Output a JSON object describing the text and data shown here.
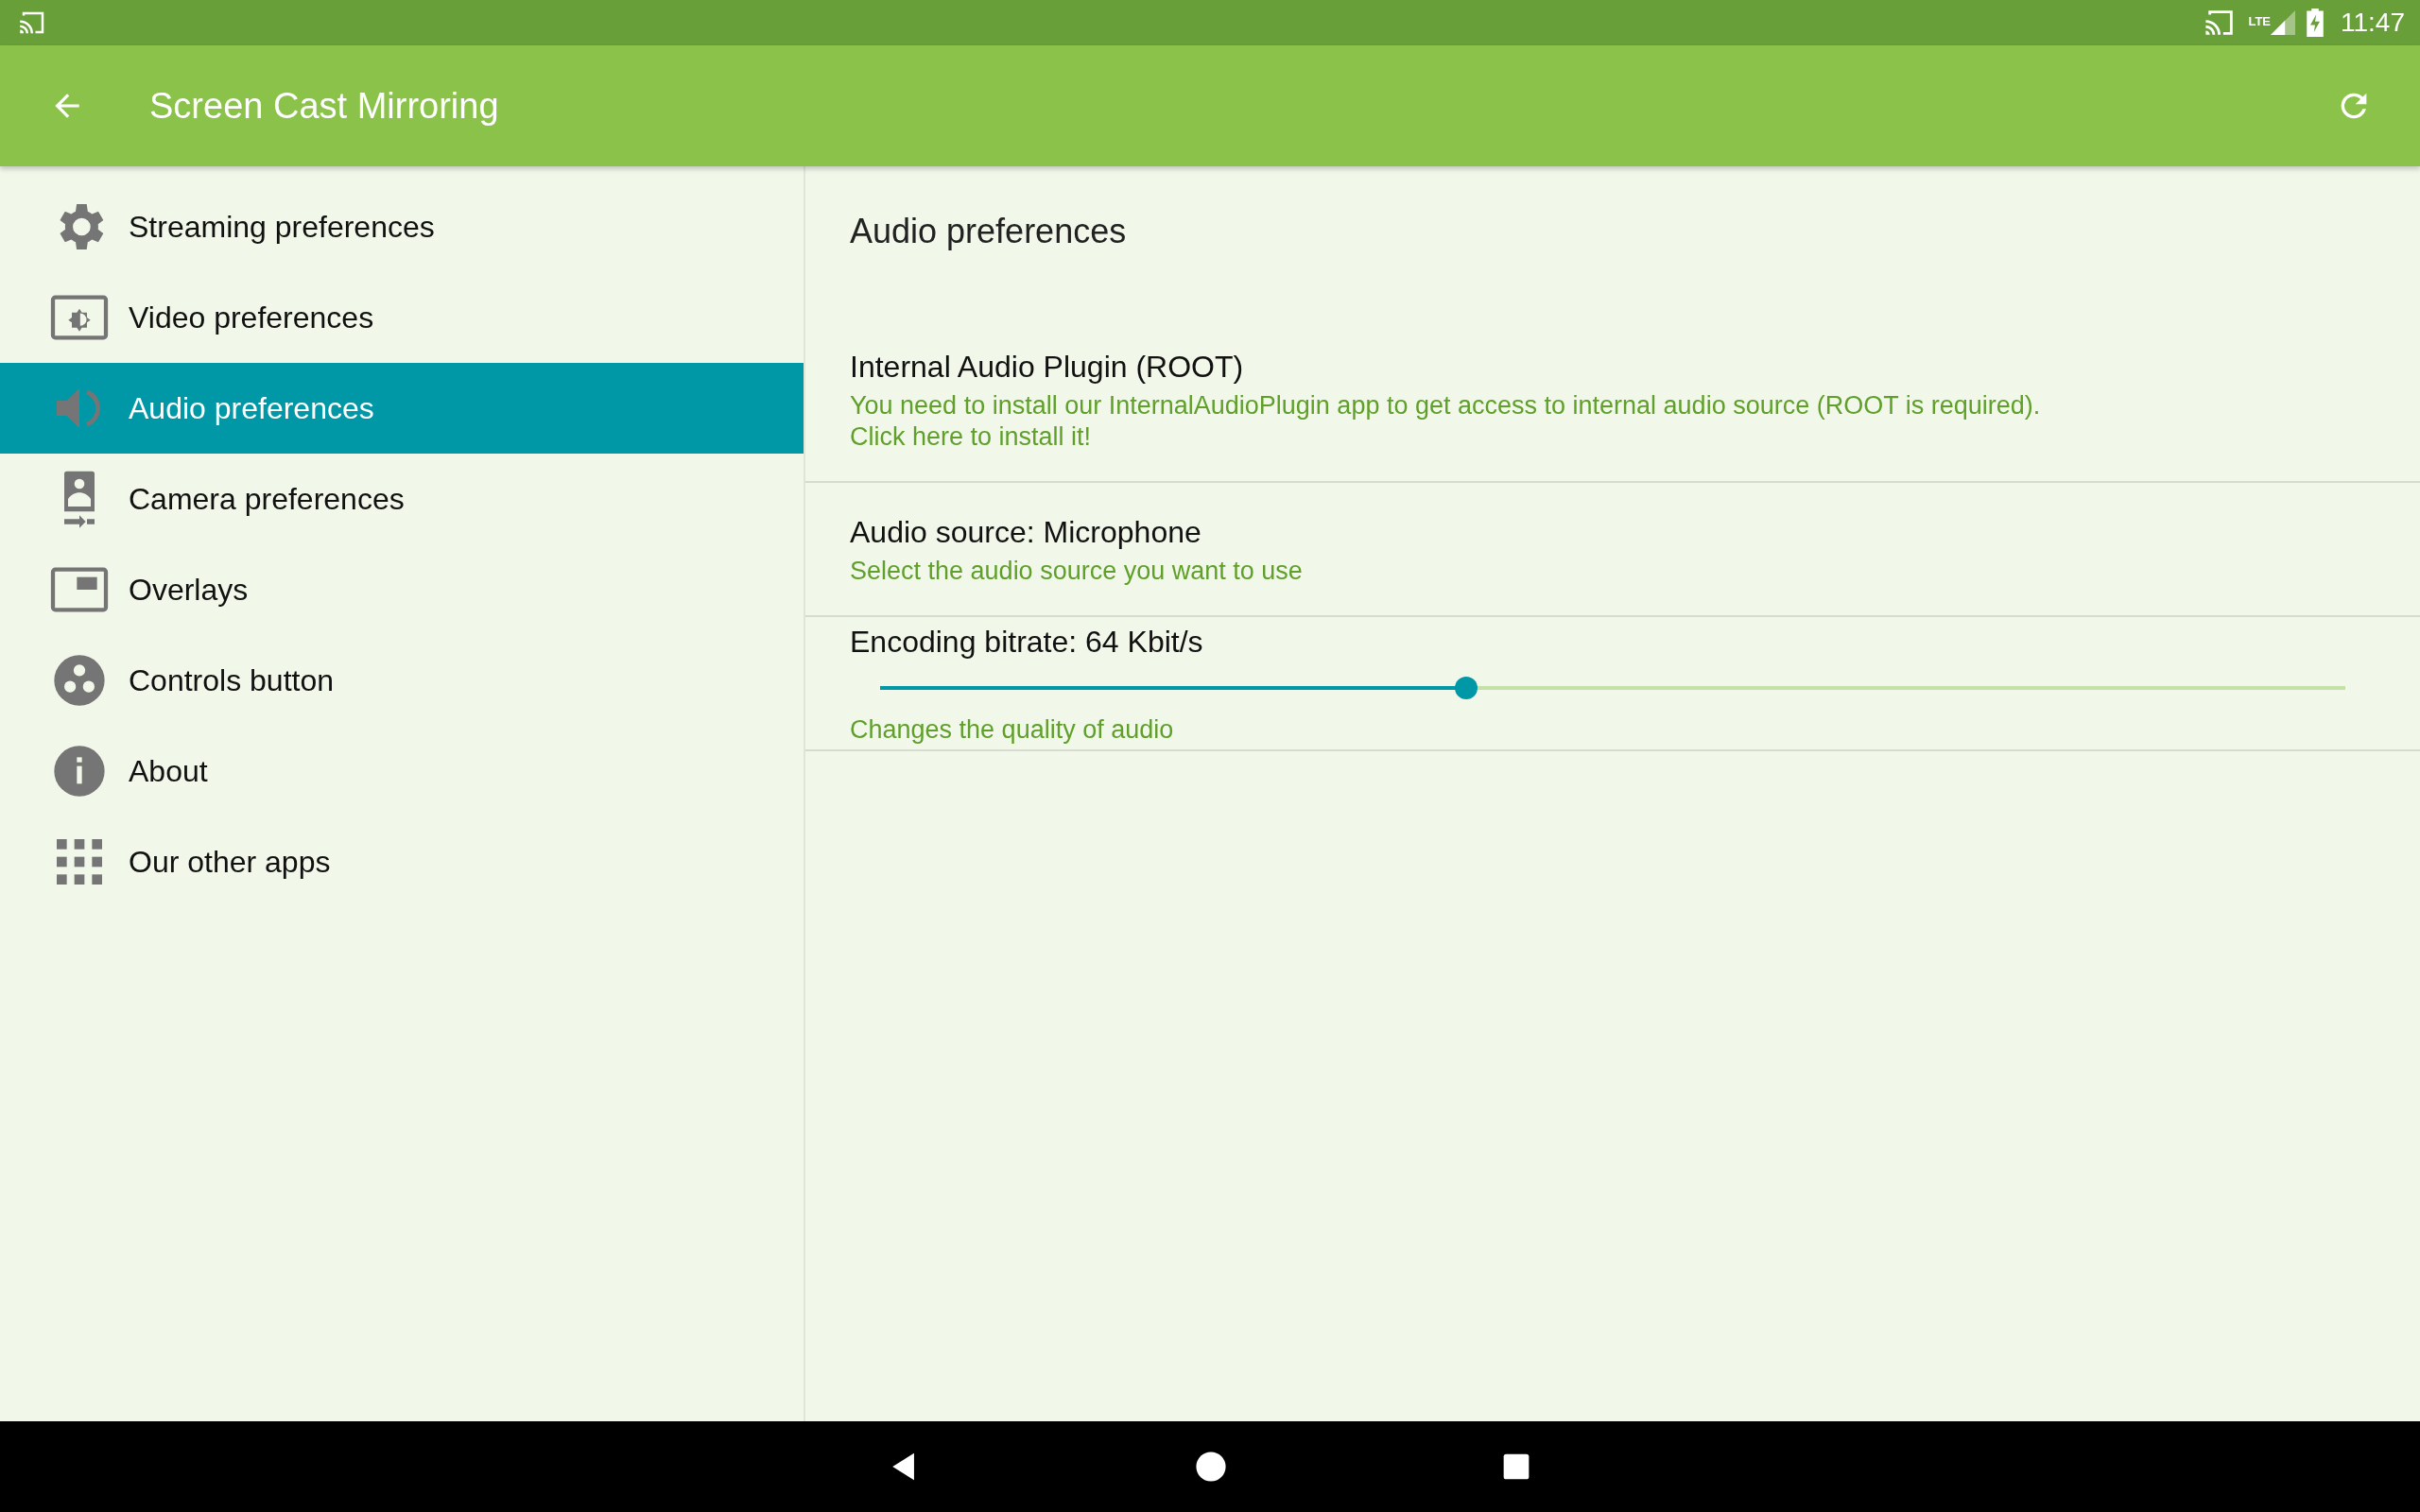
{
  "status_bar": {
    "time": "11:47",
    "network": "LTE"
  },
  "app_bar": {
    "title": "Screen Cast Mirroring"
  },
  "sidebar": {
    "items": [
      {
        "kind": "gear",
        "label": "Streaming preferences",
        "selected": false
      },
      {
        "kind": "video",
        "label": "Video preferences",
        "selected": false
      },
      {
        "kind": "audio",
        "label": "Audio preferences",
        "selected": true
      },
      {
        "kind": "camera",
        "label": "Camera preferences",
        "selected": false
      },
      {
        "kind": "overlay",
        "label": "Overlays",
        "selected": false
      },
      {
        "kind": "controls",
        "label": "Controls button",
        "selected": false
      },
      {
        "kind": "about",
        "label": "About",
        "selected": false
      },
      {
        "kind": "apps",
        "label": "Our other apps",
        "selected": false
      }
    ]
  },
  "content": {
    "title": "Audio preferences",
    "preferences": [
      {
        "kind": "text",
        "title": "Internal Audio Plugin (ROOT)",
        "summary": "You need to install our InternalAudioPlugin app to get access to internal audio source (ROOT is required).\nClick here to install it!"
      },
      {
        "kind": "text",
        "title": "Audio source: Microphone",
        "summary": "Select the audio source you want to use"
      },
      {
        "kind": "slider",
        "title": "Encoding bitrate: 64 Kbit/s",
        "level": 0.4,
        "summary": "Changes the quality of audio"
      }
    ]
  }
}
